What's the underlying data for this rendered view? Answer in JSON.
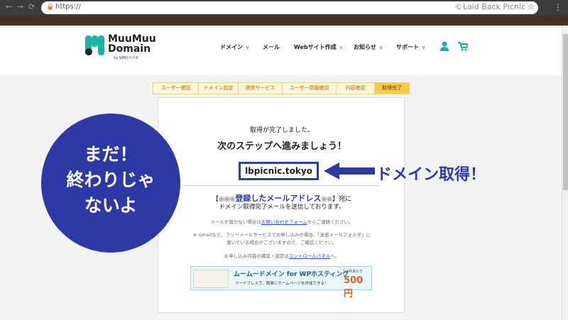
{
  "browser": {
    "url": "https://",
    "watermark": "©Laid Back Picnic"
  },
  "header": {
    "logo_line1": "MuuMuu",
    "logo_line2": "Domain",
    "logo_sub": "by GMOペパボ",
    "nav": [
      {
        "label": "ドメイン",
        "has_dropdown": true
      },
      {
        "label": "メール",
        "has_dropdown": false
      },
      {
        "label": "Webサイト作成",
        "has_dropdown": true
      },
      {
        "label": "お知らせ",
        "has_dropdown": true
      },
      {
        "label": "サポート",
        "has_dropdown": true
      }
    ]
  },
  "steps": [
    "ユーザー確認",
    "ドメイン設定",
    "連携サービス",
    "ユーザー情報確認",
    "内容確認",
    "取得完了"
  ],
  "main": {
    "done": "取得が完了しました。",
    "next": "次のステップへ進みましょう！",
    "domain": "lbpicnic.tokyo",
    "mail_bracket_open": "【",
    "mail_address_label": "登録したメールアドレス",
    "mail_bracket_close": "】宛に",
    "mail_line2": "ドメイン取得完了メールを送信しております。",
    "no_mail_pre": "メールが届かない場合は",
    "no_mail_link": "お問い合わせフォーム",
    "no_mail_post": "からご連絡ください。",
    "gmail_note1": "※ Gmailなど、フリーメールサービスでお申し込みの場合、「迷惑メールフォルダ」に",
    "gmail_note2": "届いている場合がございますので、ご確認ください。",
    "confirm_pre": "お申し込み内容の確認・設定は",
    "confirm_link": "コントロールパネル",
    "confirm_post": "へ。"
  },
  "banner": {
    "title": "ムームードメイン for WPホスティング",
    "sub": "ワードプレスで、簡単にホームページを作成できる！",
    "price_note": "1ヶ月あたり",
    "price": "500円"
  },
  "overlay": {
    "circle_lines": [
      "まだ！",
      "終わりじゃ",
      "ないよ"
    ],
    "arrow_label": "ドメイン取得！"
  },
  "colors": {
    "accent": "#2d3aa6",
    "brand_teal": "#19b5a0",
    "step_active": "#f7c84a"
  }
}
